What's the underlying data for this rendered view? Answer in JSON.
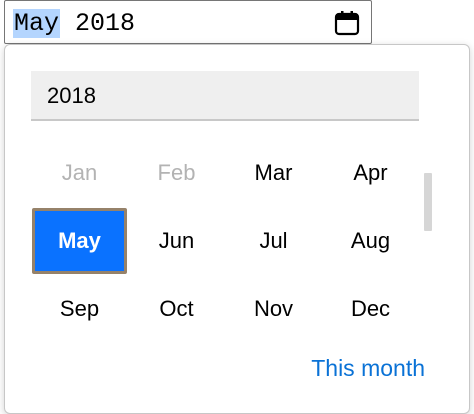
{
  "input": {
    "month_segment": "May",
    "year_segment": "2018"
  },
  "picker": {
    "year_label": "2018",
    "months": [
      {
        "label": "Jan",
        "state": "disabled"
      },
      {
        "label": "Feb",
        "state": "disabled"
      },
      {
        "label": "Mar",
        "state": "normal"
      },
      {
        "label": "Apr",
        "state": "normal"
      },
      {
        "label": "May",
        "state": "selected"
      },
      {
        "label": "Jun",
        "state": "normal"
      },
      {
        "label": "Jul",
        "state": "normal"
      },
      {
        "label": "Aug",
        "state": "normal"
      },
      {
        "label": "Sep",
        "state": "normal"
      },
      {
        "label": "Oct",
        "state": "normal"
      },
      {
        "label": "Nov",
        "state": "normal"
      },
      {
        "label": "Dec",
        "state": "normal"
      }
    ],
    "this_month_label": "This month"
  },
  "icons": {
    "calendar": "calendar-icon"
  },
  "colors": {
    "accent": "#0a72ff",
    "link": "#0a72d6",
    "disabled_text": "#b3b3b3",
    "selection_highlight": "#b4d5fe"
  }
}
